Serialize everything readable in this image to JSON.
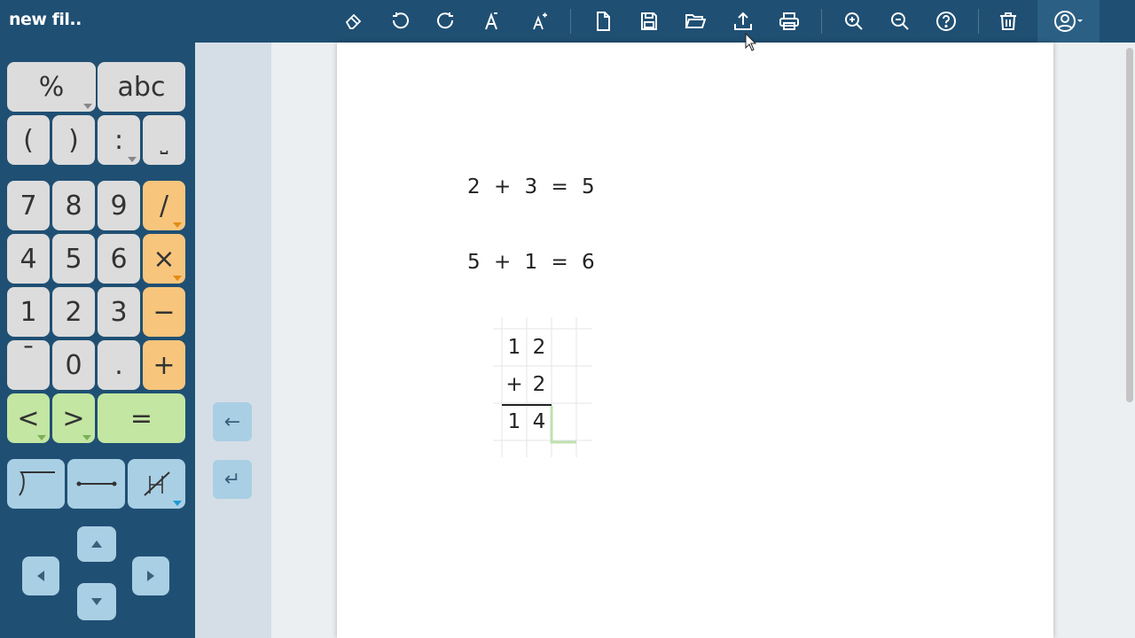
{
  "app": {
    "doc_title": "new fil.."
  },
  "toolbar": {
    "icons": [
      "eraser-icon",
      "undo-icon",
      "redo-icon",
      "font-decrease-icon",
      "font-increase-icon",
      "new-file-icon",
      "save-icon",
      "open-folder-icon",
      "upload-icon",
      "print-icon",
      "zoom-in-icon",
      "zoom-out-icon",
      "help-icon",
      "trash-icon",
      "user-account-icon"
    ]
  },
  "keypad": {
    "percent": "%",
    "abc": "abc",
    "lparen": "(",
    "rparen": ")",
    "colon": ":",
    "space": "⎵",
    "digits": {
      "7": "7",
      "8": "8",
      "9": "9",
      "4": "4",
      "5": "5",
      "6": "6",
      "1": "1",
      "2": "2",
      "3": "3",
      "0": "0"
    },
    "divide": "/",
    "multiply": "×",
    "minus": "−",
    "plus": "+",
    "negative": "¯",
    "decimal": ".",
    "less": "<",
    "greater": ">",
    "equals": "="
  },
  "side": {
    "backspace": "←",
    "enter": "↵"
  },
  "worksheet": {
    "eq1": "2 + 3 = 5",
    "eq2": "5 + 1 = 6",
    "column_addition": {
      "row1": [
        "",
        "1",
        "2",
        ""
      ],
      "row2": [
        "",
        "+",
        "2",
        ""
      ],
      "row3": [
        "",
        "1",
        "4",
        ""
      ]
    }
  },
  "colors": {
    "topbar": "#1f4f72",
    "key_gray": "#dcdcdc",
    "key_orange": "#f8c57c",
    "key_green": "#c3e6a2",
    "key_blue": "#a9cfe4"
  }
}
